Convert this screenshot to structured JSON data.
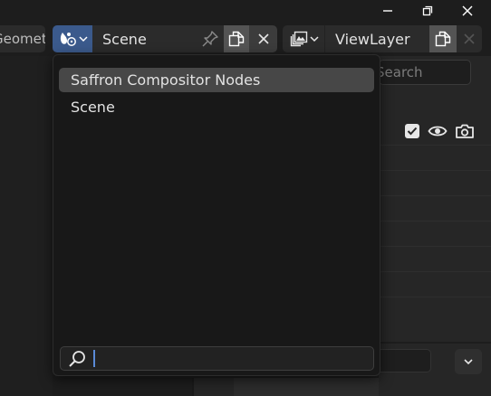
{
  "window": {
    "minimize_icon": "minimize-icon",
    "maximize_icon": "maximize-icon",
    "close_icon": "close-icon"
  },
  "left_tab": {
    "label": "Geometry"
  },
  "scene_selector": {
    "icon": "scene-icon",
    "value": "Scene",
    "pin_icon": "pin-icon",
    "new_icon": "duplicate-icon",
    "delete_icon": "close-icon",
    "accent": "#3b5a8c"
  },
  "view_layer_selector": {
    "icon": "render-layers-icon",
    "value": "ViewLayer",
    "new_icon": "duplicate-icon",
    "delete_icon": "close-icon"
  },
  "outliner": {
    "search_placeholder": "Search",
    "icons": [
      "checkbox-icon",
      "eye-icon",
      "camera-icon"
    ]
  },
  "scene_dropdown": {
    "items": [
      {
        "label": "Saffron Compositor Nodes",
        "highlighted": true
      },
      {
        "label": "Scene",
        "highlighted": false
      }
    ],
    "search_value": "",
    "search_icon": "magnifier-icon",
    "caret_color": "#5a8ad6"
  }
}
